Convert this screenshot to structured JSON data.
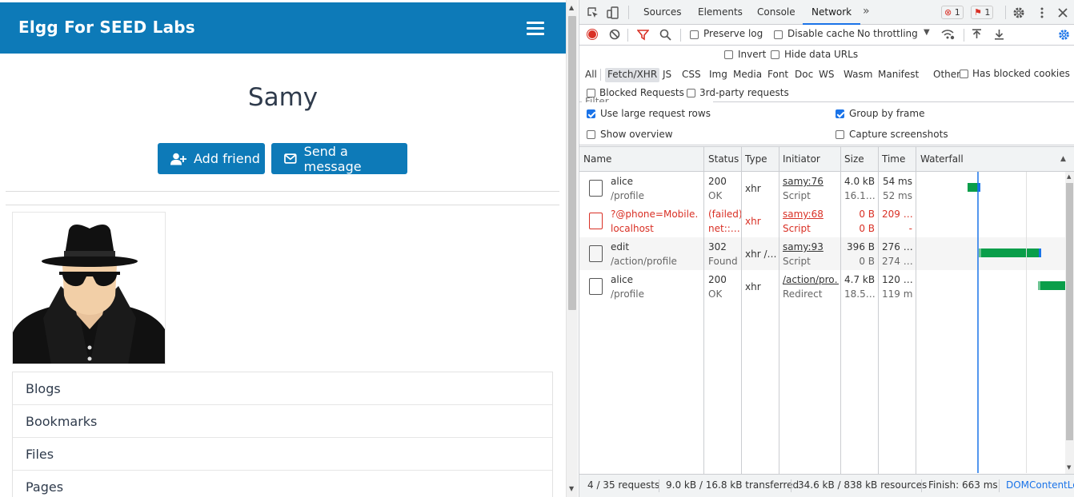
{
  "site": {
    "title": "Elgg For SEED Labs",
    "profile_name": "Samy",
    "add_friend_label": "Add friend",
    "send_message_label": "Send a message",
    "menu": [
      "Blogs",
      "Bookmarks",
      "Files",
      "Pages"
    ]
  },
  "devtools": {
    "tabs": [
      "Sources",
      "Elements",
      "Console",
      "Network"
    ],
    "active_tab": "Network",
    "more_tabs": "»",
    "error_count": "1",
    "issue_count": "1",
    "toolbar": {
      "preserve_log": "Preserve log",
      "disable_cache": "Disable cache",
      "throttling": "No throttling"
    },
    "filter": {
      "placeholder": "Filter",
      "invert": "Invert",
      "hide_data_urls": "Hide data URLs",
      "types": [
        "All",
        "Fetch/XHR",
        "JS",
        "CSS",
        "Img",
        "Media",
        "Font",
        "Doc",
        "WS",
        "Wasm",
        "Manifest",
        "Other"
      ],
      "active_type": "Fetch/XHR",
      "has_blocked_cookies": "Has blocked cookies",
      "blocked_requests": "Blocked Requests",
      "third_party": "3rd-party requests"
    },
    "settings": {
      "large_rows": "Use large request rows",
      "group_by_frame": "Group by frame",
      "show_overview": "Show overview",
      "capture_screenshots": "Capture screenshots"
    },
    "columns": [
      "Name",
      "Status",
      "Type",
      "Initiator",
      "Size",
      "Time",
      "Waterfall"
    ],
    "rows": [
      {
        "name": "alice",
        "path": "/profile",
        "status": "200",
        "status_text": "OK",
        "type": "xhr",
        "initiator": "samy:76",
        "initiator_type": "Script",
        "size": "4.0 kB",
        "size_sub": "16.1…",
        "time": "54 ms",
        "time_sub": "52 ms",
        "failed": false
      },
      {
        "name": "?@phone=Mobile…",
        "path": "localhost",
        "status": "(failed)",
        "status_text": "net::…",
        "type": "xhr",
        "initiator": "samy:68",
        "initiator_type": "Script",
        "size": "0 B",
        "size_sub": "0 B",
        "time": "209 …",
        "time_sub": "-",
        "failed": true
      },
      {
        "name": "edit",
        "path": "/action/profile",
        "status": "302",
        "status_text": "Found",
        "type": "xhr /…",
        "initiator": "samy:93",
        "initiator_type": "Script",
        "size": "396 B",
        "size_sub": "0 B",
        "time": "276 …",
        "time_sub": "274 …",
        "failed": false
      },
      {
        "name": "alice",
        "path": "/profile",
        "status": "200",
        "status_text": "OK",
        "type": "xhr",
        "initiator": "/action/pro…",
        "initiator_type": "Redirect",
        "size": "4.7 kB",
        "size_sub": "18.5…",
        "time": "120 …",
        "time_sub": "119 ms",
        "failed": false
      }
    ],
    "status_bar": {
      "requests": "4 / 35 requests",
      "transferred": "9.0 kB / 16.8 kB transferred",
      "resources": "34.6 kB / 838 kB resources",
      "finish": "Finish: 663 ms",
      "dom_content_loaded": "DOMContentLo"
    },
    "colors": {
      "accent": "#1a73e8",
      "error": "#d93025",
      "waterfall_green": "#0a9e4a",
      "header_blue": "#0d7ab8"
    }
  }
}
